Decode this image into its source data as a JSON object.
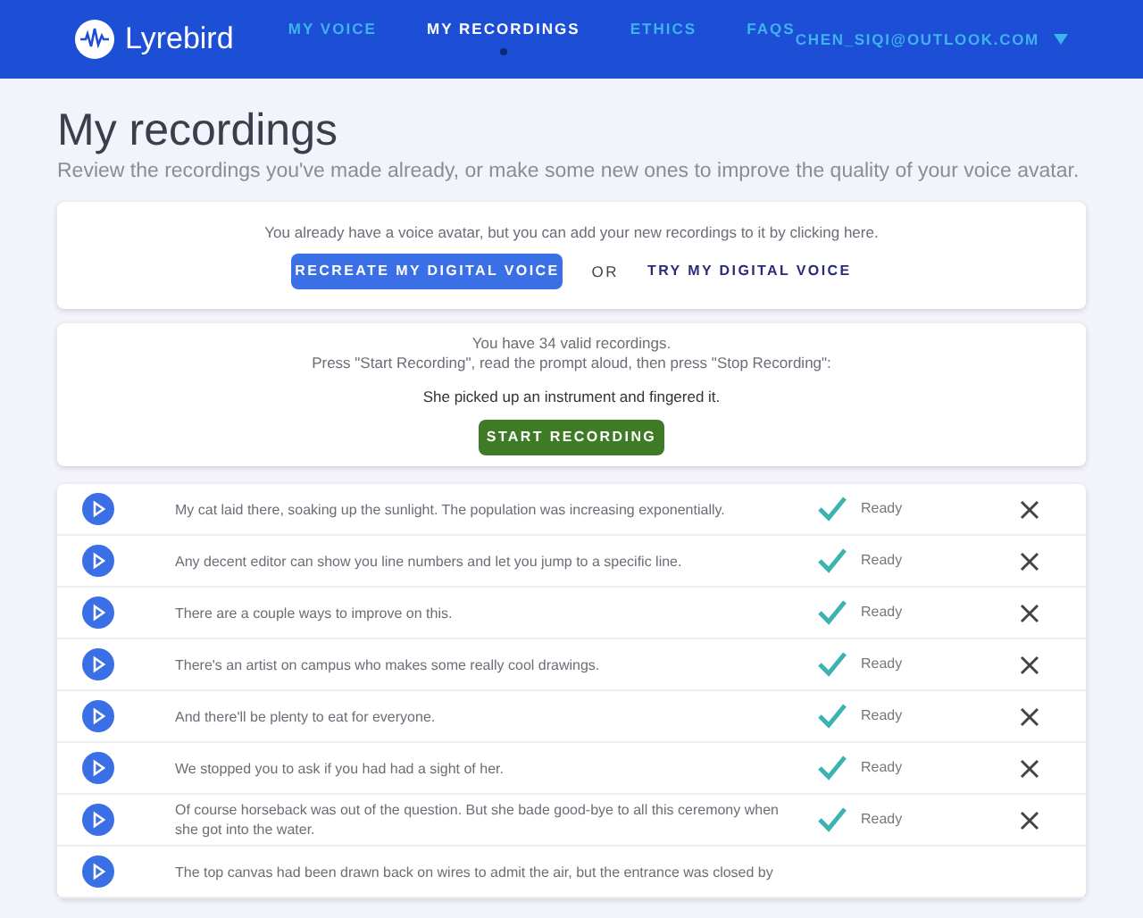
{
  "header": {
    "logo": "Lyrebird",
    "nav": [
      {
        "label": "MY VOICE",
        "selected": false
      },
      {
        "label": "MY RECORDINGS",
        "selected": true
      },
      {
        "label": "ETHICS",
        "selected": false
      },
      {
        "label": "FAQS",
        "selected": false
      }
    ],
    "account": "CHEN_SIQI@OUTLOOK.COM"
  },
  "page": {
    "title": "My recordings",
    "subtitle": "Review the recordings you've made already, or make some new ones to improve the quality of your voice avatar."
  },
  "avatar_card": {
    "message": "You already have a voice avatar, but you can add your new recordings to it by clicking here.",
    "primary_button": "RECREATE MY DIGITAL VOICE",
    "separator": "OR",
    "link": "TRY MY DIGITAL VOICE"
  },
  "record_card": {
    "count_text": "You have 34 valid recordings.",
    "instruction": "Press \"Start Recording\", read the prompt aloud, then press \"Stop Recording\":",
    "prompt": "She picked up an instrument and fingered it.",
    "button": "START RECORDING"
  },
  "recordings": [
    {
      "text": "My cat laid there, soaking up the sunlight. The population was increasing exponentially.",
      "status": "Ready"
    },
    {
      "text": "Any decent editor can show you line numbers and let you jump to a specific line.",
      "status": "Ready"
    },
    {
      "text": "There are a couple ways to improve on this.",
      "status": "Ready"
    },
    {
      "text": "There's an artist on campus who makes some really cool drawings.",
      "status": "Ready"
    },
    {
      "text": "And there'll be plenty to eat for everyone.",
      "status": "Ready"
    },
    {
      "text": "We stopped you to ask if you had had a sight of her.",
      "status": "Ready"
    },
    {
      "text": "Of course horseback was out of the question. But she bade good-bye to all this ceremony when she got into the water.",
      "status": "Ready"
    },
    {
      "text": "The top canvas had been drawn back on wires to admit the air, but the entrance was closed by"
    }
  ]
}
